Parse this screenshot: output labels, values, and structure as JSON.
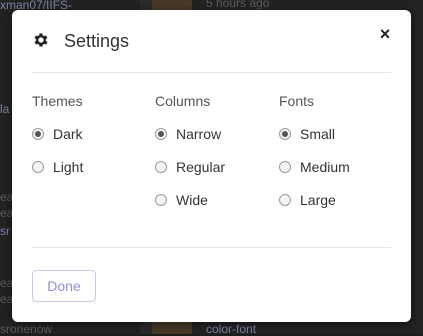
{
  "background": {
    "snippets": [
      "xman07/IIFS-",
      "5 hours ago",
      "la",
      "ea",
      "ea",
      "sr",
      "ea",
      "ea",
      "sronenow",
      "color-font"
    ]
  },
  "modal": {
    "title": "Settings",
    "close_label": "×",
    "groups": [
      {
        "label": "Themes",
        "options": [
          {
            "label": "Dark",
            "checked": true
          },
          {
            "label": "Light",
            "checked": false
          }
        ]
      },
      {
        "label": "Columns",
        "options": [
          {
            "label": "Narrow",
            "checked": true
          },
          {
            "label": "Regular",
            "checked": false
          },
          {
            "label": "Wide",
            "checked": false
          }
        ]
      },
      {
        "label": "Fonts",
        "options": [
          {
            "label": "Small",
            "checked": true
          },
          {
            "label": "Medium",
            "checked": false
          },
          {
            "label": "Large",
            "checked": false
          }
        ]
      }
    ],
    "done_label": "Done"
  }
}
